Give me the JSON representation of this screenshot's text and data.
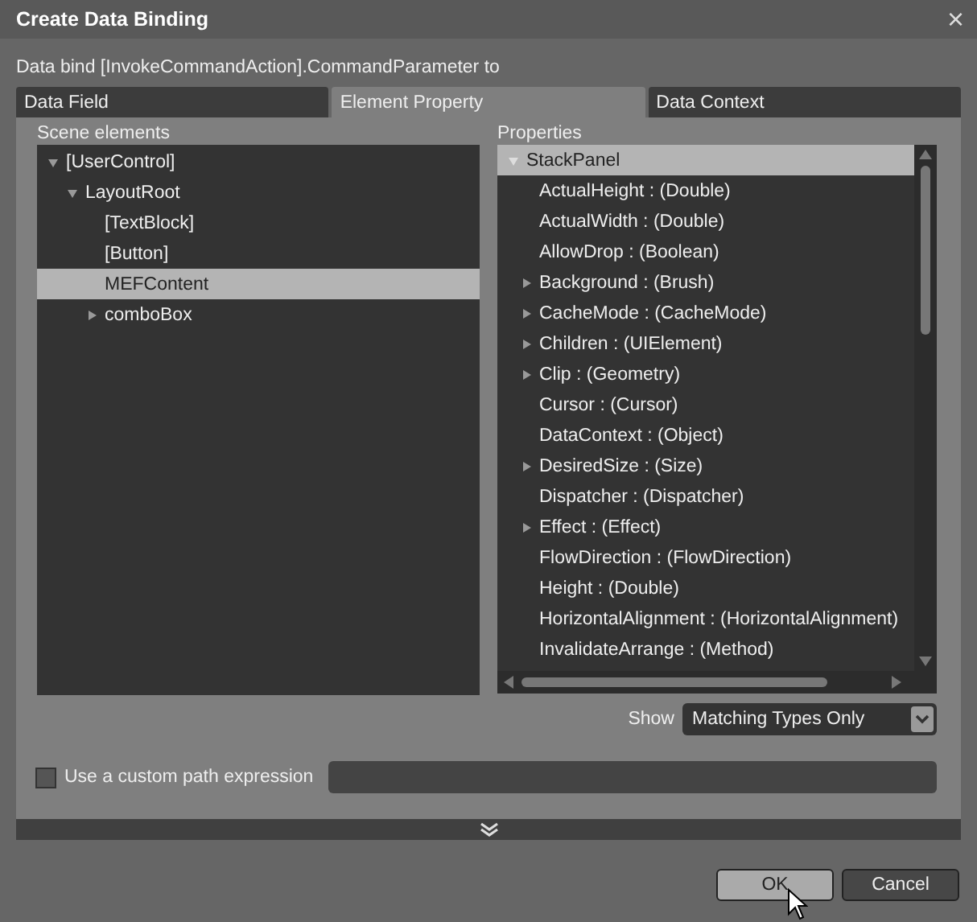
{
  "window": {
    "title": "Create Data Binding",
    "close": "×"
  },
  "prompt": "Data bind [InvokeCommandAction].CommandParameter to",
  "tabs": [
    {
      "label": "Data Field",
      "selected": false
    },
    {
      "label": "Element Property",
      "selected": true
    },
    {
      "label": "Data Context",
      "selected": false
    }
  ],
  "scene_elements": {
    "label": "Scene elements",
    "items": [
      {
        "label": "[UserControl]",
        "expanded": true,
        "selected": false,
        "children": [
          {
            "label": "LayoutRoot",
            "expanded": true,
            "selected": false,
            "children": [
              {
                "label": "[TextBlock]",
                "selected": false
              },
              {
                "label": "[Button]",
                "selected": false
              },
              {
                "label": "MEFContent",
                "selected": true
              },
              {
                "label": "comboBox",
                "expanded": false,
                "selected": false
              }
            ]
          }
        ]
      }
    ]
  },
  "properties": {
    "label": "Properties",
    "header": {
      "label": "StackPanel",
      "selected": true
    },
    "items": [
      {
        "label": "ActualHeight : (Double)"
      },
      {
        "label": "ActualWidth : (Double)"
      },
      {
        "label": "AllowDrop : (Boolean)"
      },
      {
        "label": "Background : (Brush)",
        "expanded": false
      },
      {
        "label": "CacheMode : (CacheMode)",
        "expanded": false
      },
      {
        "label": "Children : (UIElement)",
        "expanded": false
      },
      {
        "label": "Clip : (Geometry)",
        "expanded": false
      },
      {
        "label": "Cursor : (Cursor)"
      },
      {
        "label": "DataContext : (Object)"
      },
      {
        "label": "DesiredSize : (Size)",
        "expanded": false
      },
      {
        "label": "Dispatcher : (Dispatcher)"
      },
      {
        "label": "Effect : (Effect)",
        "expanded": false
      },
      {
        "label": "FlowDirection : (FlowDirection)"
      },
      {
        "label": "Height : (Double)"
      },
      {
        "label": "HorizontalAlignment : (HorizontalAlignment)"
      },
      {
        "label": "InvalidateArrange : (Method)"
      }
    ]
  },
  "show": {
    "label": "Show",
    "value": "Matching Types Only"
  },
  "custom_path": {
    "label": "Use a custom path expression",
    "checked": false
  },
  "buttons": [
    {
      "label": "OK",
      "default": true
    },
    {
      "label": "Cancel",
      "default": false
    }
  ]
}
